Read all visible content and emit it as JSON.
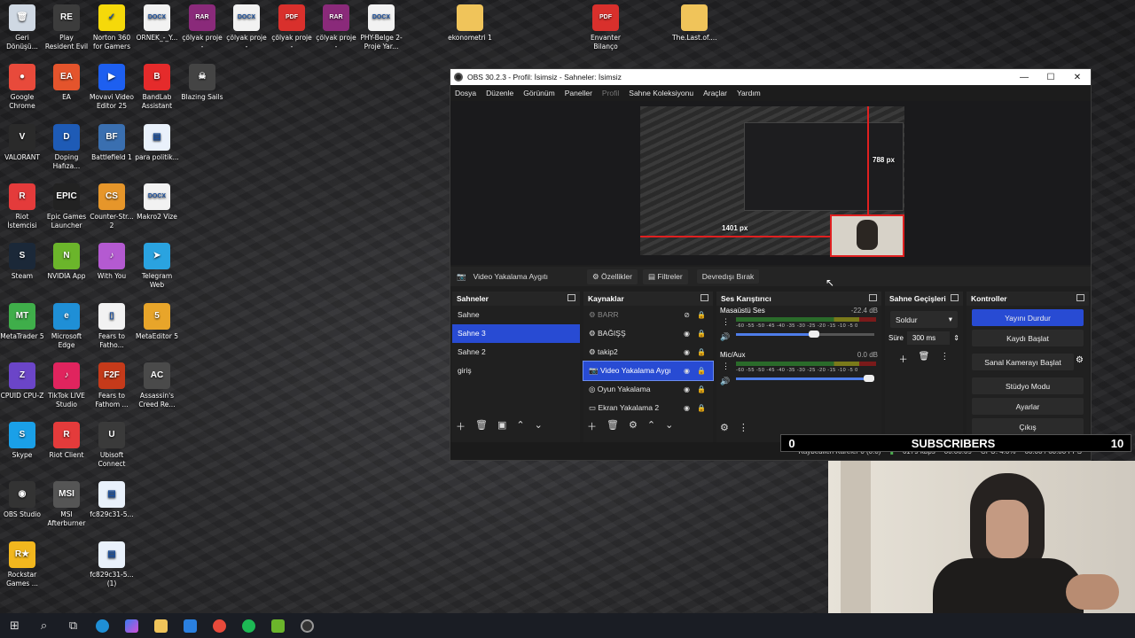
{
  "desktop": {
    "icons": [
      {
        "label": "Geri Dönüşü...",
        "glyph": "🗑",
        "color": "#cfd8e3"
      },
      {
        "label": "Play Resident Evil 4 Remake",
        "glyph": "RE",
        "color": "#3c3c3c"
      },
      {
        "label": "Norton 360 for Gamers",
        "glyph": "✓",
        "color": "#f5d90a"
      },
      {
        "label": "ORNEK_-_Y...",
        "glyph": "DOCX",
        "color": "#f2f2f2"
      },
      {
        "label": "çölyak proje -b221802044",
        "glyph": "RAR",
        "color": "#8a2a7a"
      },
      {
        "label": "çölyak proje -b221802044",
        "glyph": "DOCX",
        "color": "#f2f2f2"
      },
      {
        "label": "çölyak proje -b221802044",
        "glyph": "PDF",
        "color": "#d9302c"
      },
      {
        "label": "çölyak proje -b221802044",
        "glyph": "RAR",
        "color": "#8a2a7a"
      },
      {
        "label": "PHY-Belge 2-Proje Yar...",
        "glyph": "DOCX",
        "color": "#f2f2f2"
      },
      {
        "label": "ekonometri 1",
        "glyph": "",
        "color": "#f0c45a"
      },
      {
        "label": "Envanter Bilanço",
        "glyph": "PDF",
        "color": "#d9302c"
      },
      {
        "label": "The.Last.of....",
        "glyph": "",
        "color": "#f0c45a"
      },
      {
        "label": "Google Chrome",
        "glyph": "●",
        "color": "#e84a3b"
      },
      {
        "label": "EA",
        "glyph": "EA",
        "color": "#e4542c"
      },
      {
        "label": "Movavi Video Editor 25",
        "glyph": "▶",
        "color": "#1d5ff0"
      },
      {
        "label": "BandLab Assistant",
        "glyph": "B",
        "color": "#e52b2b"
      },
      {
        "label": "Blazing Sails",
        "glyph": "☠",
        "color": "#444"
      },
      {
        "label": "VALORANT",
        "glyph": "V",
        "color": "#2a2a2a"
      },
      {
        "label": "Doping Hafıza...",
        "glyph": "D",
        "color": "#1e5bb6"
      },
      {
        "label": "Battlefield 1",
        "glyph": "BF",
        "color": "#3a6fb0"
      },
      {
        "label": "para politik...",
        "glyph": "▤",
        "color": "#e9f1fb"
      },
      {
        "label": "Riot İstemcisi",
        "glyph": "R",
        "color": "#e43b3b"
      },
      {
        "label": "Epic Games Launcher",
        "glyph": "EPIC",
        "color": "#222"
      },
      {
        "label": "Counter-Str... 2",
        "glyph": "CS",
        "color": "#e6962a"
      },
      {
        "label": "Makro2 Vize",
        "glyph": "DOCX",
        "color": "#f2f2f2"
      },
      {
        "label": "Steam",
        "glyph": "S",
        "color": "#1b2838"
      },
      {
        "label": "NVIDIA App",
        "glyph": "N",
        "color": "#6bb52b"
      },
      {
        "label": "With You",
        "glyph": "♪",
        "color": "#b45ad1"
      },
      {
        "label": "Telegram Web",
        "glyph": "➤",
        "color": "#2aa3e0"
      },
      {
        "label": "MetaTrader 5",
        "glyph": "MT",
        "color": "#3fae4a"
      },
      {
        "label": "Microsoft Edge",
        "glyph": "e",
        "color": "#1f8fd6"
      },
      {
        "label": "Fears to Fatho...",
        "glyph": "▯",
        "color": "#f2f2f2"
      },
      {
        "label": "MetaEditor 5",
        "glyph": "5",
        "color": "#e8a52a"
      },
      {
        "label": "CPUID CPU-Z",
        "glyph": "Z",
        "color": "#6b45c8"
      },
      {
        "label": "TikTok LIVE Studio",
        "glyph": "♪",
        "color": "#e0245e"
      },
      {
        "label": "Fears to Fathom ...",
        "glyph": "F2F",
        "color": "#c53a1a"
      },
      {
        "label": "Assassin's Creed Re...",
        "glyph": "AC",
        "color": "#4a4a4a"
      },
      {
        "label": "Skype",
        "glyph": "S",
        "color": "#1aa0e8"
      },
      {
        "label": "Riot Client",
        "glyph": "R",
        "color": "#e43b3b"
      },
      {
        "label": "Ubisoft Connect",
        "glyph": "U",
        "color": "#3a3a3a"
      },
      {
        "label": "OBS Studio",
        "glyph": "◉",
        "color": "#333"
      },
      {
        "label": "MSI Afterburner",
        "glyph": "MSI",
        "color": "#555"
      },
      {
        "label": "fc829c31-5...",
        "glyph": "▤",
        "color": "#e9f1fb"
      },
      {
        "label": "Rockstar Games ...",
        "glyph": "R★",
        "color": "#f2b71e"
      },
      {
        "label": "fc829c31-5... (1)",
        "glyph": "▤",
        "color": "#e9f1fb"
      }
    ]
  },
  "obs": {
    "title": "OBS 30.2.3 - Profil: İsimsiz - Sahneler: İsimsiz",
    "menu": [
      "Dosya",
      "Düzenle",
      "Görünüm",
      "Paneller",
      "Profil",
      "Sahne Koleksiyonu",
      "Araçlar",
      "Yardım"
    ],
    "preview": {
      "height_label": "788 px",
      "width_label": "1401 px"
    },
    "source_bar": {
      "name": "Video Yakalama Aygıtı",
      "properties": "Özellikler",
      "filters": "Filtreler",
      "deactivate": "Devredışı Bırak"
    },
    "scenes": {
      "title": "Sahneler",
      "items": [
        "Sahne",
        "Sahne 3",
        "Sahne 2",
        "giriş"
      ],
      "selected": 1
    },
    "sources": {
      "title": "Kaynaklar",
      "items": [
        {
          "name": "BARR",
          "visible": false
        },
        {
          "name": "BAĞIŞŞ",
          "visible": true
        },
        {
          "name": "takip2",
          "visible": true
        },
        {
          "name": "Video Yakalama Aygı",
          "visible": true
        },
        {
          "name": "Oyun Yakalama",
          "visible": true
        },
        {
          "name": "Ekran Yakalama 2",
          "visible": true
        }
      ],
      "selected": 3
    },
    "mixer": {
      "title": "Ses Karıştırıcı",
      "channels": [
        {
          "name": "Masaüstü Ses",
          "db": "-22.4 dB",
          "volume": 0.6
        },
        {
          "name": "Mic/Aux",
          "db": "0.0 dB",
          "volume": 1.0
        }
      ],
      "scale": "-60 -55 -50 -45 -40 -35 -30 -25 -20 -15 -10 -5 0"
    },
    "transitions": {
      "title": "Sahne Geçişleri",
      "type": "Soldur",
      "duration_label": "Süre",
      "duration": "300 ms"
    },
    "controls": {
      "title": "Kontroller",
      "buttons": [
        "Yayını Durdur",
        "Kaydı Başlat",
        "Sanal Kamerayı Başlat",
        "Stüdyo Modu",
        "Ayarlar",
        "Çıkış"
      ]
    },
    "status": {
      "dropped": "Kaybedilen Kareler 0 (0.0)",
      "bitrate": "6179 kbps",
      "time": "00:00:09",
      "cpu": "CPU: 4.0%",
      "fps": "60.00 / 60.00 FPS"
    }
  },
  "overlay": {
    "left": "0",
    "title": "SUBSCRIBERS",
    "right": "10"
  }
}
